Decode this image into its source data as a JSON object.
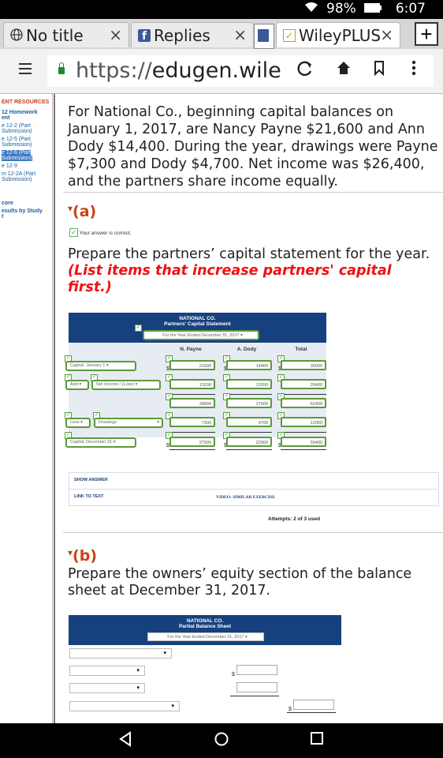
{
  "status": {
    "battery": "98%",
    "time": "6:07"
  },
  "tabs": [
    {
      "label": "No title",
      "close": "×"
    },
    {
      "label": "Replies",
      "close": "×"
    },
    {
      "label": "WileyPLUS",
      "close": "×"
    }
  ],
  "new_tab": "+",
  "url": {
    "scheme": "https://",
    "host": "edugen.wile"
  },
  "leftnav": [
    "ENT RESOURCES",
    "12 Homework",
    "ent",
    "e 12-2 (Part",
    "Submission)",
    "e 12-5 (Part",
    "Submission)",
    "e 12-6 (Part",
    "Submission)",
    "e 12-9",
    "m 12-2A (Part",
    "Submission)",
    "core",
    "esults by Study",
    "t"
  ],
  "problem_text": "For National Co., beginning capital balances on January 1, 2017, are Nancy Payne $21,600 and Ann Dody $14,400. During the year, drawings were Payne $7,300 and Dody $4,700. Net income was $26,400, and the partners share income equally.",
  "part_a": {
    "label": "(a)",
    "correct_msg": "Your answer is correct.",
    "prompt": "Prepare the partners’ capital statement for the year.",
    "instruction": "(List items that increase partners' capital first.)",
    "statement": {
      "company": "NATIONAL CO.",
      "title": "Partners' Capital Statement",
      "period": "For the Year Ended December 31, 2017",
      "columns": [
        "N. Payne",
        "A. Dody",
        "Total"
      ],
      "rows": [
        {
          "prefix": "",
          "label": "Capital, January 1",
          "payne": "21600",
          "dody": "14400",
          "total": "36000"
        },
        {
          "prefix": "Add",
          "label": "Net Income / (Loss)",
          "payne": "13200",
          "dody": "13200",
          "total": "26400"
        },
        {
          "prefix": "",
          "label": "",
          "payne": "34800",
          "dody": "27600",
          "total": "62400"
        },
        {
          "prefix": "Less",
          "label": "Drawings",
          "payne": "7300",
          "dody": "4700",
          "total": "12000"
        },
        {
          "prefix": "",
          "label": "Capital, December 31",
          "payne": "27500",
          "dody": "22900",
          "total": "50400"
        }
      ],
      "dollar": "$"
    },
    "show_answer": "SHOW ANSWER",
    "link_to_text": "LINK TO TEXT",
    "video": "VIDEO: SIMILAR EXERCISE",
    "attempts": "Attempts: 2 of 3 used"
  },
  "part_b": {
    "label": "(b)",
    "prompt": "Prepare the owners’ equity section of the balance sheet at December 31, 2017.",
    "sheet": {
      "company": "NATIONAL CO.",
      "title": "Partial Balance Sheet",
      "period": "For the Year Ended December 31, 2017",
      "dollar": "$"
    }
  }
}
